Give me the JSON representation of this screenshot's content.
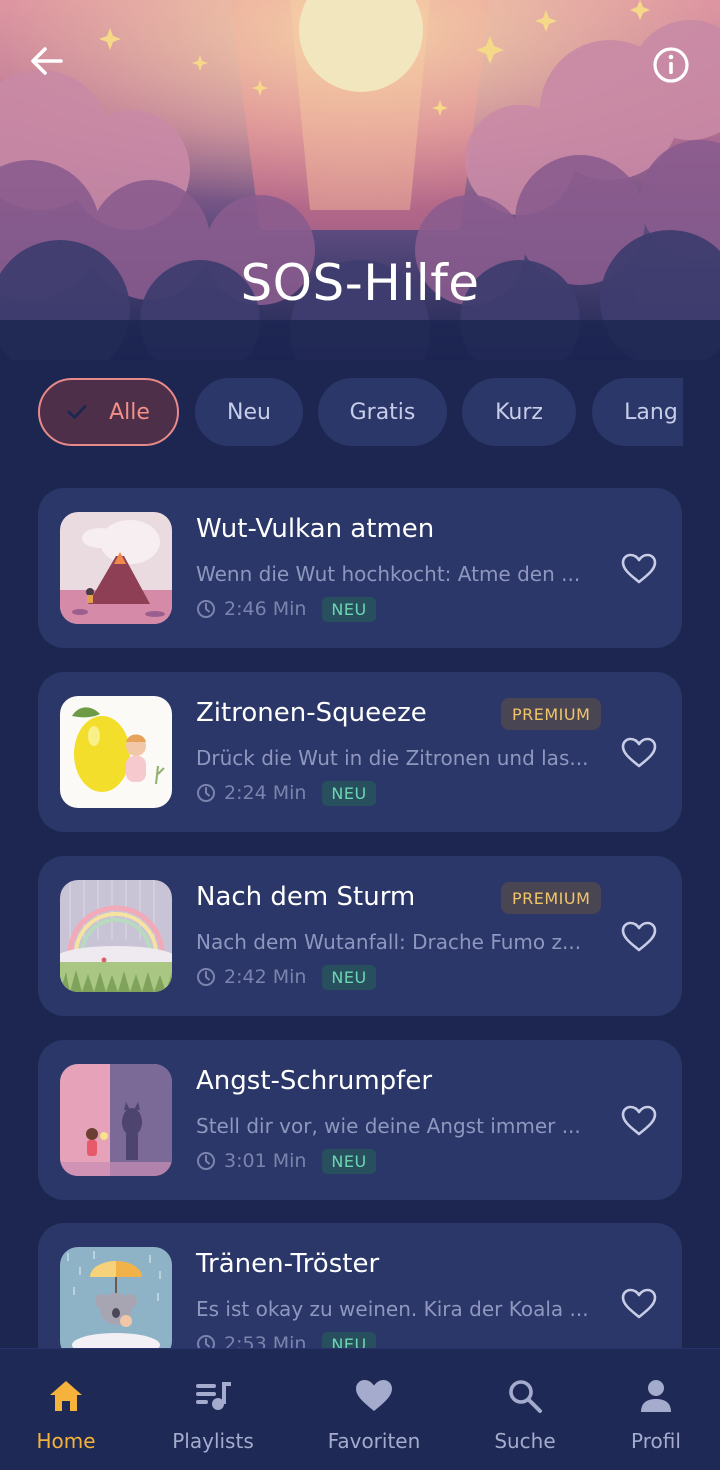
{
  "header": {
    "title": "SOS-Hilfe",
    "back_icon": "arrow-left-icon",
    "info_icon": "info-circle-icon"
  },
  "filters": {
    "selected": "Alle",
    "chips": [
      {
        "label": "Alle",
        "active": true
      },
      {
        "label": "Neu",
        "active": false
      },
      {
        "label": "Gratis",
        "active": false
      },
      {
        "label": "Kurz",
        "active": false
      },
      {
        "label": "Lang",
        "active": false
      }
    ]
  },
  "items": [
    {
      "title": "Wut-Vulkan atmen",
      "description": "Wenn die Wut hochkocht: Atme den ...",
      "duration": "2:46 Min",
      "badge": "NEU",
      "premium": ""
    },
    {
      "title": "Zitronen-Squeeze",
      "description": "Drück die Wut in die Zitronen und las...",
      "duration": "2:24 Min",
      "badge": "NEU",
      "premium": "PREMIUM"
    },
    {
      "title": "Nach dem Sturm",
      "description": "Nach dem Wutanfall: Drache Fumo z...",
      "duration": "2:42 Min",
      "badge": "NEU",
      "premium": "PREMIUM"
    },
    {
      "title": "Angst-Schrumpfer",
      "description": "Stell dir vor, wie deine Angst immer ...",
      "duration": "3:01 Min",
      "badge": "NEU",
      "premium": ""
    },
    {
      "title": "Tränen-Tröster",
      "description": "Es ist okay zu weinen. Kira der Koala ...",
      "duration": "2:53 Min",
      "badge": "NEU",
      "premium": ""
    }
  ],
  "bottom_nav": {
    "active": "Home",
    "items": [
      {
        "label": "Home",
        "icon": "home-icon"
      },
      {
        "label": "Playlists",
        "icon": "playlist-icon"
      },
      {
        "label": "Favoriten",
        "icon": "heart-icon"
      },
      {
        "label": "Suche",
        "icon": "search-icon"
      },
      {
        "label": "Profil",
        "icon": "person-icon"
      }
    ]
  },
  "colors": {
    "background": "#1c2651",
    "card": "#2b3768",
    "accent_active_chip": "#f28f86",
    "accent_nav": "#f5b33b",
    "badge_new": "#6fd6b3",
    "badge_premium": "#f0c56a"
  }
}
